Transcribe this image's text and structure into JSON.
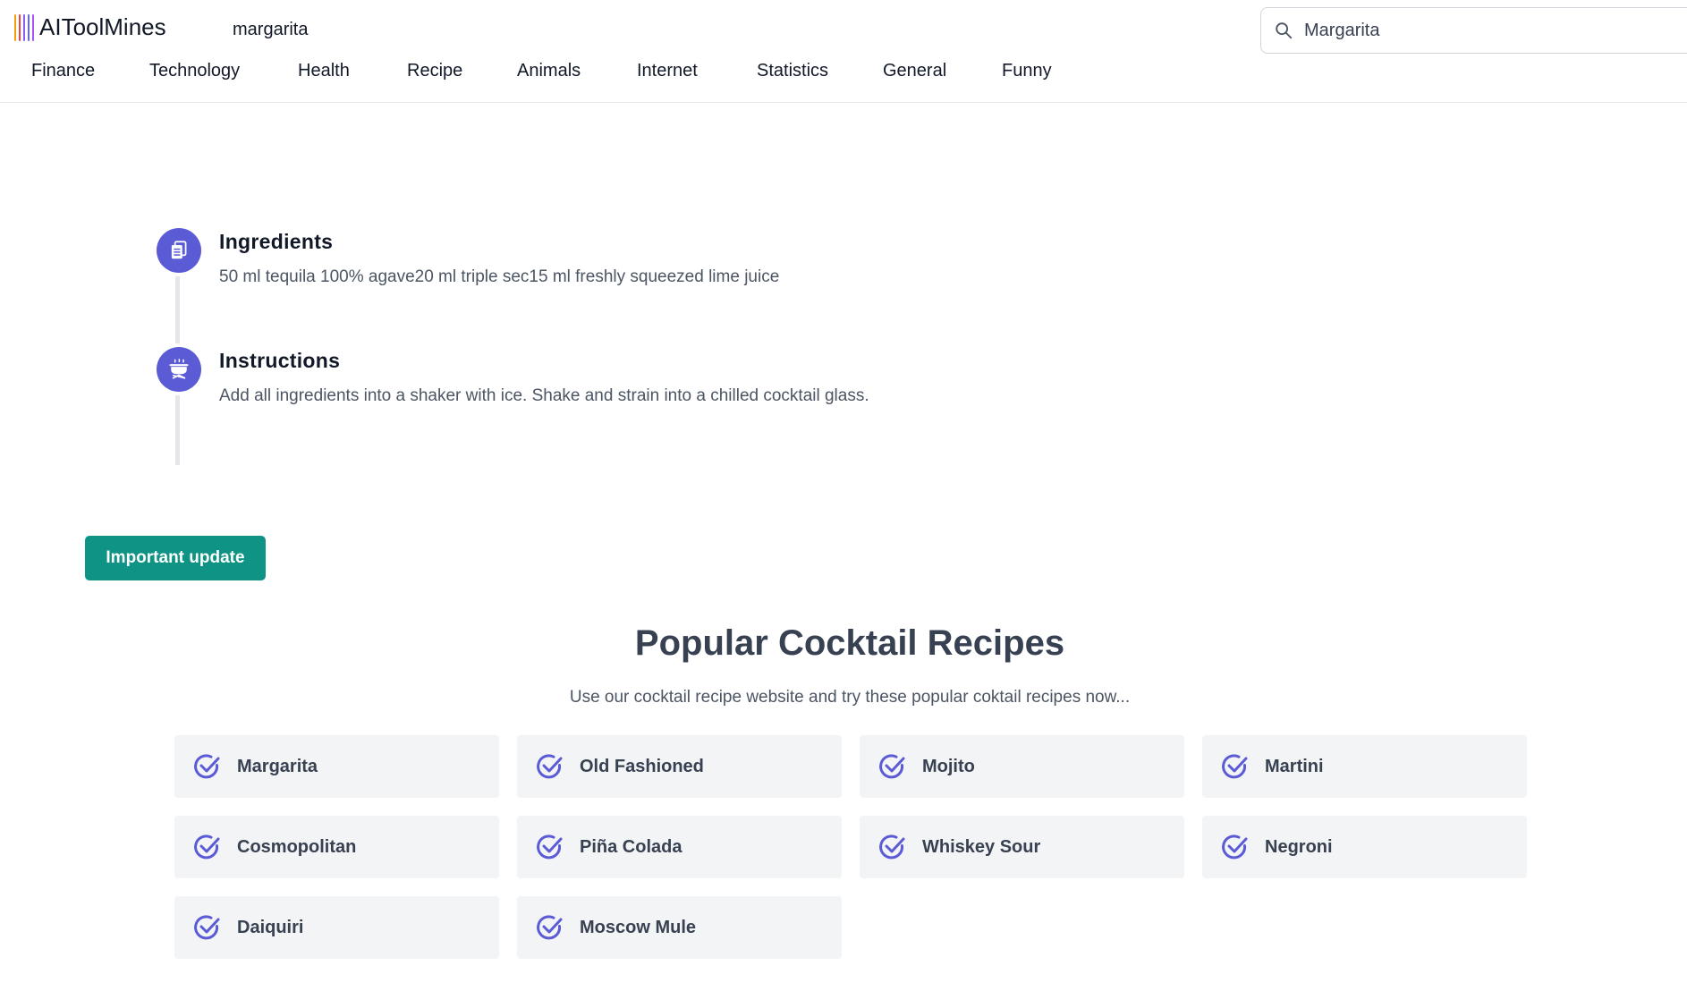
{
  "header": {
    "logo_text": "AIToolMines",
    "page_slug": "margarita",
    "search": {
      "value": "Margarita",
      "placeholder": "Search"
    },
    "nav": [
      "Finance",
      "Technology",
      "Health",
      "Recipe",
      "Animals",
      "Internet",
      "Statistics",
      "General",
      "Funny"
    ]
  },
  "timeline": {
    "ingredients": {
      "title": "Ingredients",
      "text": "50 ml tequila 100% agave20 ml triple sec15 ml freshly squeezed lime juice",
      "icon": "clipboard-icon"
    },
    "instructions": {
      "title": "Instructions",
      "text": "Add all ingredients into a shaker with ice. Shake and strain into a chilled cocktail glass.",
      "icon": "cooking-pot-icon"
    }
  },
  "update_button": "Important update",
  "popular": {
    "title": "Popular Cocktail Recipes",
    "subtitle": "Use our cocktail recipe website and try these popular coktail recipes now...",
    "recipes": [
      "Margarita",
      "Old Fashioned",
      "Mojito",
      "Martini",
      "Cosmopolitan",
      "Piña Colada",
      "Whiskey Sour",
      "Negroni",
      "Daiquiri",
      "Moscow Mule"
    ]
  },
  "colors": {
    "accent": "#5b5bd6",
    "button": "#0e9384",
    "card_bg": "#f3f4f6",
    "logo_bars": [
      "#f59e0b",
      "#ef4444",
      "#8b5cf6",
      "#6366f1",
      "#a855f7"
    ]
  }
}
